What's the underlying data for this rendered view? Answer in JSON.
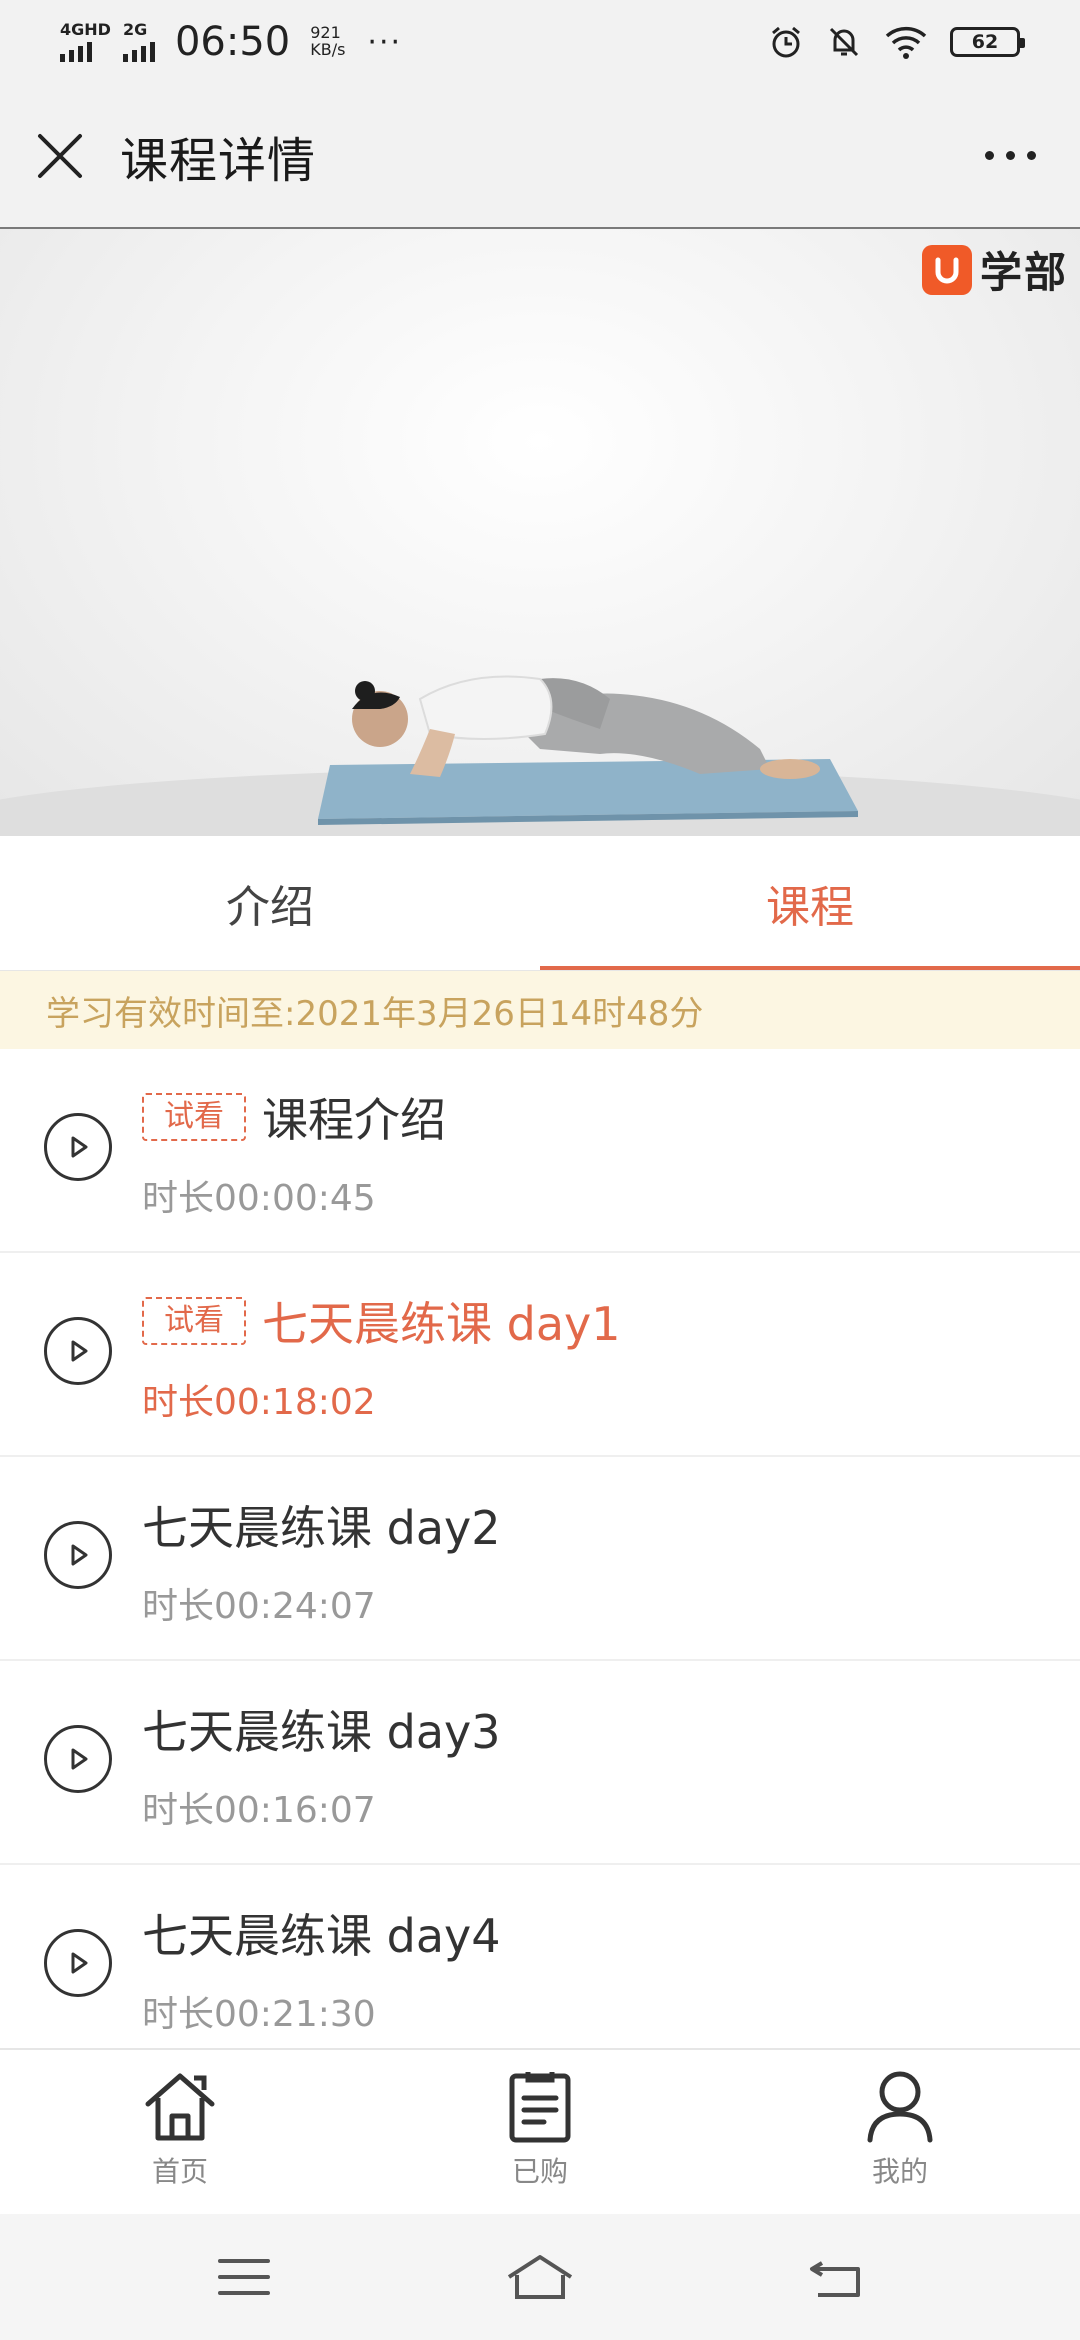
{
  "status_bar": {
    "network1": "4GHD",
    "network2": "2G",
    "time": "06:50",
    "speed_value": "921",
    "speed_unit": "KB/s",
    "overflow": "···",
    "battery": "62"
  },
  "header": {
    "title": "课程详情"
  },
  "video": {
    "brand_text": "学部"
  },
  "tabs": [
    {
      "label": "介绍",
      "active": false
    },
    {
      "label": "课程",
      "active": true
    }
  ],
  "notice": {
    "text": "学习有效时间至:2021年3月26日14时48分"
  },
  "lessons": [
    {
      "badge": "试看",
      "title": "课程介绍",
      "duration": "时长00:00:45"
    },
    {
      "badge": "试看",
      "title": "七天晨练课 day1",
      "duration": "时长00:18:02",
      "current": true
    },
    {
      "title": "七天晨练课 day2",
      "duration": "时长00:24:07"
    },
    {
      "title": "七天晨练课 day3",
      "duration": "时长00:16:07"
    },
    {
      "title": "七天晨练课 day4",
      "duration": "时长00:21:30"
    }
  ],
  "bottom_nav": [
    {
      "label": "首页",
      "icon": "home-icon"
    },
    {
      "label": "已购",
      "icon": "clipboard-icon"
    },
    {
      "label": "我的",
      "icon": "user-icon"
    }
  ],
  "system_nav": {
    "icons": [
      "menu-icon",
      "home-outline-icon",
      "back-icon"
    ]
  },
  "colors": {
    "accent": "#e2694a",
    "notice_bg": "#fcf6e2",
    "notice_text": "#c8a35e",
    "brand": "#f05a28"
  }
}
